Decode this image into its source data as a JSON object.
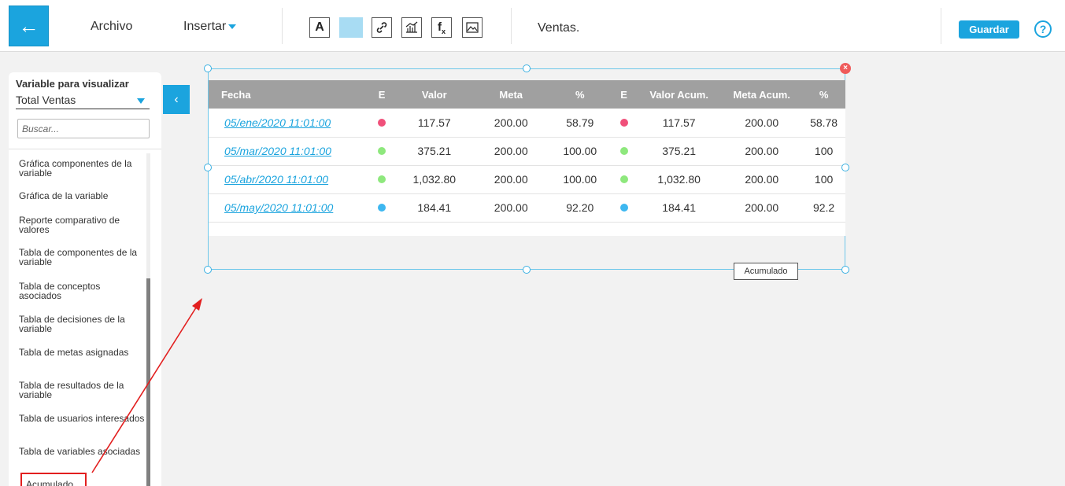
{
  "header": {
    "back_icon": "left-arrow-icon",
    "menu": {
      "archivo": "Archivo",
      "insertar": "Insertar"
    },
    "tools": [
      {
        "name": "text-tool-icon",
        "glyph": "A"
      },
      {
        "name": "color-fill-icon",
        "glyph": ""
      },
      {
        "name": "link-icon",
        "glyph": "🔗"
      },
      {
        "name": "chart-icon",
        "glyph": "📊"
      },
      {
        "name": "formula-icon",
        "glyph": "fx"
      },
      {
        "name": "image-icon",
        "glyph": "🖼"
      }
    ],
    "document_title": "Ventas.",
    "save_label": "Guardar",
    "help_glyph": "?"
  },
  "sidebar": {
    "title": "Variable para visualizar",
    "selected_variable": "Total Ventas",
    "search_placeholder": "Buscar...",
    "items": [
      "Gráfica componentes de la variable",
      "Gráfica de la variable",
      "Reporte comparativo de valores",
      "Tabla de componentes de la variable",
      "Tabla de conceptos asociados",
      "Tabla de decisiones de la variable",
      "Tabla de metas asignadas",
      "Tabla de resultados de la variable",
      "Tabla de usuarios interesados",
      "Tabla de variables asociadas",
      "Acumulado"
    ],
    "collapse_glyph": "‹"
  },
  "table": {
    "columns": [
      "Fecha",
      "E",
      "Valor",
      "Meta",
      "%",
      "E",
      "Valor Acum.",
      "Meta Acum.",
      "%"
    ],
    "rows": [
      {
        "fecha": "05/ene/2020 11:01:00",
        "e1": "#f0507a",
        "valor": "117.57",
        "meta": "200.00",
        "pct": "58.79",
        "e2": "#f0507a",
        "valor_acum": "117.57",
        "meta_acum": "200.00",
        "pct_acum": "58.78"
      },
      {
        "fecha": "05/mar/2020 11:01:00",
        "e1": "#8ee87d",
        "valor": "375.21",
        "meta": "200.00",
        "pct": "100.00",
        "e2": "#8ee87d",
        "valor_acum": "375.21",
        "meta_acum": "200.00",
        "pct_acum": "100"
      },
      {
        "fecha": "05/abr/2020 11:01:00",
        "e1": "#8ee87d",
        "valor": "1,032.80",
        "meta": "200.00",
        "pct": "100.00",
        "e2": "#8ee87d",
        "valor_acum": "1,032.80",
        "meta_acum": "200.00",
        "pct_acum": "100"
      },
      {
        "fecha": "05/may/2020 11:01:00",
        "e1": "#3db7f0",
        "valor": "184.41",
        "meta": "200.00",
        "pct": "92.20",
        "e2": "#3db7f0",
        "valor_acum": "184.41",
        "meta_acum": "200.00",
        "pct_acum": "92.2"
      }
    ]
  },
  "tooltip": "Acumulado",
  "colors": {
    "accent": "#1ba4de",
    "annotation": "#e21f1f",
    "header_gray": "#a0a0a0"
  }
}
